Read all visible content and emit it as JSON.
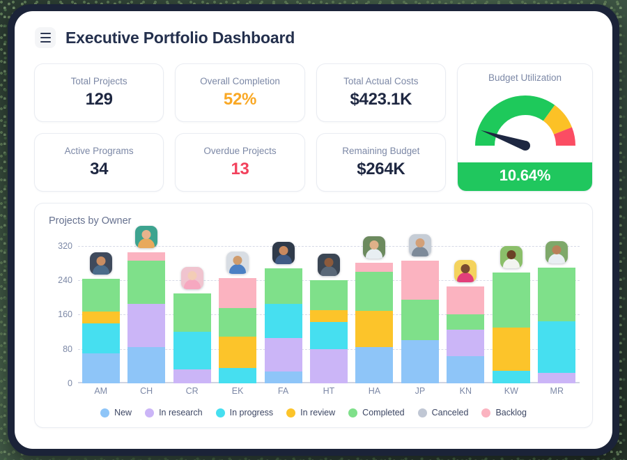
{
  "header": {
    "menu_icon": "hamburger-menu-icon",
    "title": "Executive Portfolio Dashboard"
  },
  "kpis": [
    {
      "label": "Total Projects",
      "value": "129",
      "tone": "normal"
    },
    {
      "label": "Overall Completion",
      "value": "52%",
      "tone": "warn"
    },
    {
      "label": "Total Actual Costs",
      "value": "$423.1K",
      "tone": "normal"
    },
    {
      "label": "Active Programs",
      "value": "34",
      "tone": "normal"
    },
    {
      "label": "Overdue Projects",
      "value": "13",
      "tone": "danger"
    },
    {
      "label": "Remaining Budget",
      "value": "$264K",
      "tone": "normal"
    }
  ],
  "gauge": {
    "title": "Budget Utilization",
    "value_label": "10.64%",
    "value": 10.64,
    "min": 0,
    "max": 100,
    "bands": [
      {
        "from": 0,
        "to": 70,
        "color": "#1ec95b"
      },
      {
        "from": 70,
        "to": 88,
        "color": "#fcc126"
      },
      {
        "from": 88,
        "to": 100,
        "color": "#fb4d63"
      }
    ],
    "needle_color": "#1e2741",
    "value_bar_color": "#20c75e"
  },
  "chart_data": {
    "type": "bar",
    "title": "Projects by Owner",
    "stacked": true,
    "xlabel": "",
    "ylabel": "",
    "ylim": [
      0,
      360
    ],
    "yticks": [
      0,
      80,
      160,
      240,
      320
    ],
    "grid": true,
    "legend_position": "bottom",
    "categories": [
      "AM",
      "CH",
      "CR",
      "EK",
      "FA",
      "HT",
      "HA",
      "JP",
      "KN",
      "KW",
      "MR"
    ],
    "series": [
      {
        "name": "New",
        "color": "#8ec5f8",
        "values": [
          70,
          85,
          0,
          0,
          28,
          0,
          85,
          100,
          63,
          0,
          0
        ]
      },
      {
        "name": "In research",
        "color": "#cbb5f7",
        "values": [
          0,
          100,
          32,
          0,
          77,
          80,
          0,
          0,
          62,
          0,
          25
        ]
      },
      {
        "name": "In progress",
        "color": "#46dff0",
        "values": [
          70,
          0,
          88,
          35,
          80,
          63,
          0,
          0,
          0,
          30,
          120
        ]
      },
      {
        "name": "In review",
        "color": "#fcc42a",
        "values": [
          27,
          0,
          0,
          73,
          0,
          27,
          83,
          0,
          0,
          100,
          0
        ]
      },
      {
        "name": "Completed",
        "color": "#7fe08a",
        "values": [
          77,
          100,
          90,
          67,
          82,
          70,
          92,
          95,
          35,
          128,
          125
        ]
      },
      {
        "name": "Canceled",
        "color": "#c0c7d4",
        "values": [
          0,
          0,
          0,
          0,
          0,
          0,
          0,
          0,
          0,
          0,
          0
        ]
      },
      {
        "name": "Backlog",
        "color": "#fbb3c0",
        "values": [
          0,
          20,
          0,
          70,
          0,
          0,
          20,
          90,
          65,
          0,
          0
        ]
      }
    ],
    "bar_totals": [
      244,
      305,
      210,
      245,
      267,
      240,
      280,
      285,
      225,
      258,
      270
    ],
    "avatars": [
      {
        "category": "AM",
        "bg": "#3f4a5c",
        "head": "#c98d62",
        "body": "#4a6b8a"
      },
      {
        "category": "CH",
        "bg": "#3da38f",
        "head": "#e8b38c",
        "body": "#e8a95c"
      },
      {
        "category": "CR",
        "bg": "#f0c4cf",
        "head": "#f3cdb6",
        "body": "#f6a8c0"
      },
      {
        "category": "EK",
        "bg": "#d8dde3",
        "head": "#cf9c6d",
        "body": "#4b80c4"
      },
      {
        "category": "FA",
        "bg": "#2f3a4a",
        "head": "#c9895e",
        "body": "#3f5a84"
      },
      {
        "category": "HT",
        "bg": "#3b4654",
        "head": "#8c5a3c",
        "body": "#5a6878"
      },
      {
        "category": "HA",
        "bg": "#6c8a5e",
        "head": "#e0b189",
        "body": "#e8eef2"
      },
      {
        "category": "JP",
        "bg": "#c6cdd6",
        "head": "#d3a078",
        "body": "#7d8a99"
      },
      {
        "category": "KN",
        "bg": "#f4d35e",
        "head": "#7a4a30",
        "body": "#e23f7a"
      },
      {
        "category": "KW",
        "bg": "#8bbf6a",
        "head": "#6b4226",
        "body": "#f2f4f0"
      },
      {
        "category": "MR",
        "bg": "#7ea86a",
        "head": "#b9805a",
        "body": "#e9eef3"
      }
    ]
  }
}
